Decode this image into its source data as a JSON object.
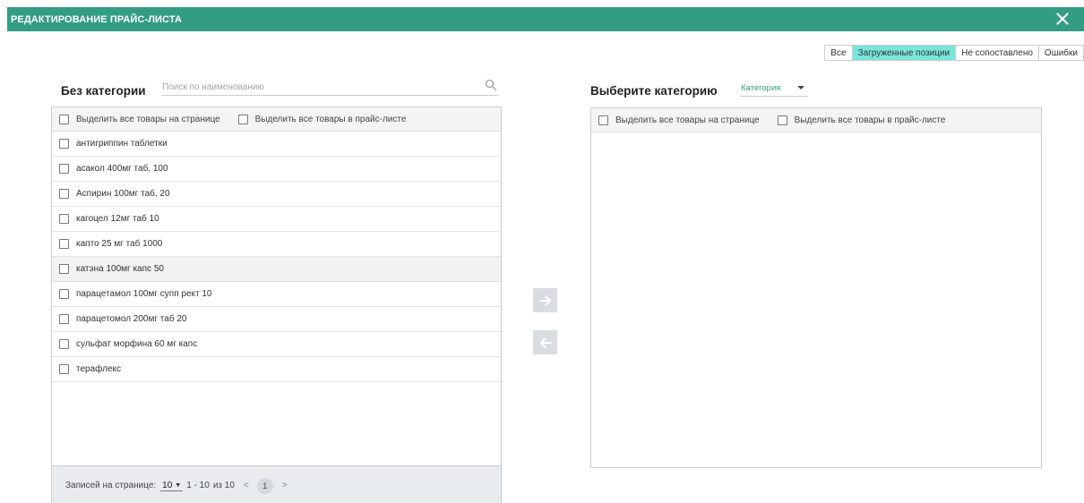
{
  "header": {
    "title": "РЕДАКТИРОВАНИЕ ПРАЙС-ЛИСТА"
  },
  "filter_tabs": [
    {
      "label": "Все",
      "active": false
    },
    {
      "label": "Загруженные позиции",
      "active": true
    },
    {
      "label": "Не сопоставлено",
      "active": false
    },
    {
      "label": "Ошибки",
      "active": false
    }
  ],
  "left": {
    "title": "Без категории",
    "search_placeholder": "Поиск по наименованию",
    "select_page": "Выделить все товары на странице",
    "select_all": "Выделить все товары в прайс-листе",
    "items": [
      "антигриппин таблетки",
      "асакол 400мг таб, 100",
      "Аспирин 100мг таб, 20",
      "кагоцел 12мг таб 10",
      "капто 25 мг таб 1000",
      "катэна 100мг капс 50",
      "парацетамол 100мг супп рект 10",
      "парацетомол 200мг таб 20",
      "сульфат морфина 60 мг капс",
      "терафлекс"
    ],
    "hovered_item": "катэна 100мг капс 50",
    "footer": {
      "per_page_label": "Записей на странице:",
      "per_page_value": "10",
      "range": "1 - 10",
      "of": "из 10",
      "prev": "<",
      "page": "1",
      "next": ">"
    }
  },
  "right": {
    "title": "Выберите категорию",
    "category_placeholder": "Категория",
    "select_page": "Выделить все товары на странице",
    "select_all": "Выделить все товары в прайс-листе"
  },
  "colors": {
    "header": "#339d84",
    "active_tab": "#79e6db",
    "accent_text": "#339d84",
    "move_button": "#d9dde1"
  },
  "icons": {
    "close": "close-icon",
    "search": "search-icon",
    "move_right": "arrow-right-icon",
    "move_left": "arrow-left-icon"
  }
}
